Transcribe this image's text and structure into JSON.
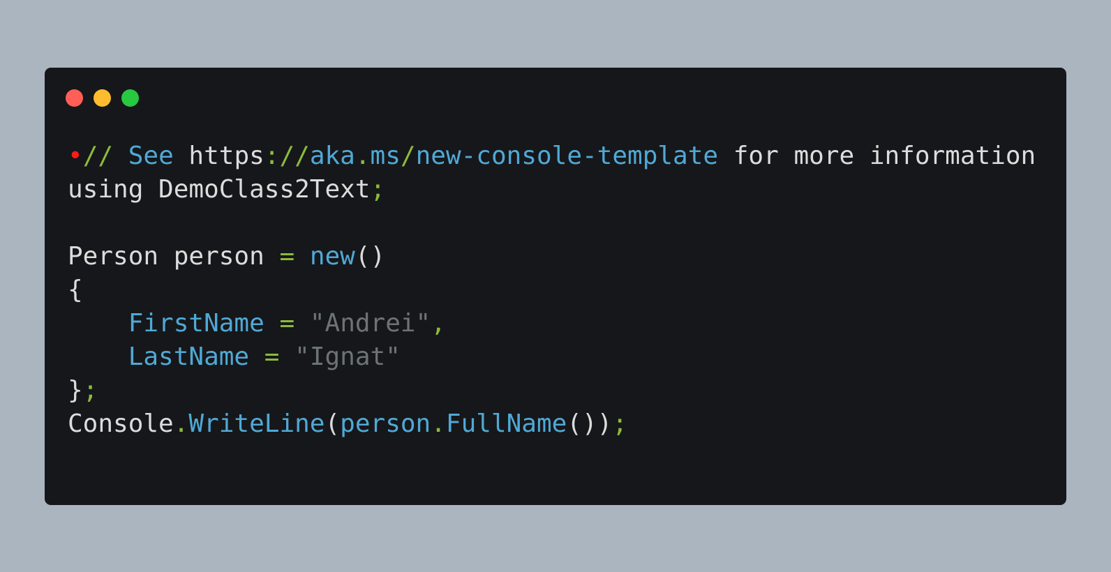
{
  "window": {
    "controls": [
      {
        "name": "close",
        "color": "#ff5f57"
      },
      {
        "name": "minimize",
        "color": "#febc2e"
      },
      {
        "name": "zoom",
        "color": "#28c840"
      }
    ]
  },
  "colors": {
    "background": "#abb5c0",
    "window": "#16171a",
    "plain": "#dcdcdc",
    "keyword": "#4fa9d6",
    "punctuation": "#8cbb3b",
    "string": "#6c7377",
    "marker": "#ff1a1a"
  },
  "code": {
    "lines": [
      [
        {
          "t": "•",
          "c": "marker"
        },
        {
          "t": "//",
          "c": "green"
        },
        {
          "t": " See",
          "c": "blue"
        },
        {
          "t": " https",
          "c": "plain"
        },
        {
          "t": "://",
          "c": "green"
        },
        {
          "t": "aka",
          "c": "blue"
        },
        {
          "t": ".",
          "c": "green"
        },
        {
          "t": "ms",
          "c": "blue"
        },
        {
          "t": "/",
          "c": "green"
        },
        {
          "t": "new-console-template",
          "c": "blue"
        },
        {
          "t": " for more information",
          "c": "plain"
        }
      ],
      [
        {
          "t": "using DemoClass2Text",
          "c": "plain"
        },
        {
          "t": ";",
          "c": "green"
        }
      ],
      [],
      [
        {
          "t": "Person person ",
          "c": "plain"
        },
        {
          "t": "=",
          "c": "green"
        },
        {
          "t": " ",
          "c": "plain"
        },
        {
          "t": "new",
          "c": "blue"
        },
        {
          "t": "()",
          "c": "plain"
        }
      ],
      [
        {
          "t": "{",
          "c": "plain"
        }
      ],
      [
        {
          "t": "    ",
          "c": "plain"
        },
        {
          "t": "FirstName",
          "c": "blue"
        },
        {
          "t": " ",
          "c": "plain"
        },
        {
          "t": "=",
          "c": "green"
        },
        {
          "t": " ",
          "c": "plain"
        },
        {
          "t": "\"Andrei\"",
          "c": "string"
        },
        {
          "t": ",",
          "c": "green"
        }
      ],
      [
        {
          "t": "    ",
          "c": "plain"
        },
        {
          "t": "LastName",
          "c": "blue"
        },
        {
          "t": " ",
          "c": "plain"
        },
        {
          "t": "=",
          "c": "green"
        },
        {
          "t": " ",
          "c": "plain"
        },
        {
          "t": "\"Ignat\"",
          "c": "string"
        }
      ],
      [
        {
          "t": "}",
          "c": "plain"
        },
        {
          "t": ";",
          "c": "green"
        }
      ],
      [
        {
          "t": "Console",
          "c": "plain"
        },
        {
          "t": ".",
          "c": "green"
        },
        {
          "t": "WriteLine",
          "c": "blue"
        },
        {
          "t": "(",
          "c": "plain"
        },
        {
          "t": "person",
          "c": "blue"
        },
        {
          "t": ".",
          "c": "green"
        },
        {
          "t": "FullName",
          "c": "blue"
        },
        {
          "t": "())",
          "c": "plain"
        },
        {
          "t": ";",
          "c": "green"
        }
      ]
    ]
  }
}
